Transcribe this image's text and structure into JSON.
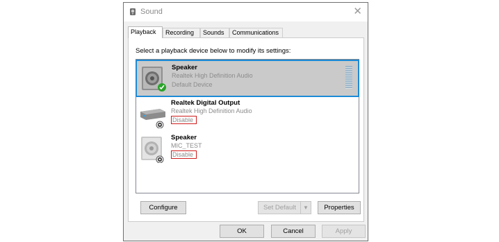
{
  "window": {
    "title": "Sound",
    "close_glyph": "✕",
    "icon": "speaker-app-icon"
  },
  "tabs": [
    {
      "label": "Playback",
      "active": true
    },
    {
      "label": "Recording",
      "active": false
    },
    {
      "label": "Sounds",
      "active": false
    },
    {
      "label": "Communications",
      "active": false
    }
  ],
  "instruction": "Select a playback device below to modify its settings:",
  "devices": [
    {
      "name": "Speaker",
      "line1": "Realtek High Definition Audio",
      "line2": "Default Device",
      "status_icon": "green-check-icon",
      "selected": true
    },
    {
      "name": "Realtek Digital Output",
      "line1": "Realtek High Definition Audio",
      "line2": "Disable",
      "status_icon": "disabled-down-arrow-icon",
      "selected": false
    },
    {
      "name": "Speaker",
      "line1": "MIC_TEST",
      "line2": "Disable",
      "status_icon": "disabled-down-arrow-icon",
      "selected": false
    }
  ],
  "buttons": {
    "configure": "Configure",
    "set_default": "Set Default",
    "properties": "Properties",
    "ok": "OK",
    "cancel": "Cancel",
    "apply": "Apply"
  },
  "colors": {
    "selection_border": "#1b8ad6",
    "highlight_box": "#d01a1a"
  }
}
